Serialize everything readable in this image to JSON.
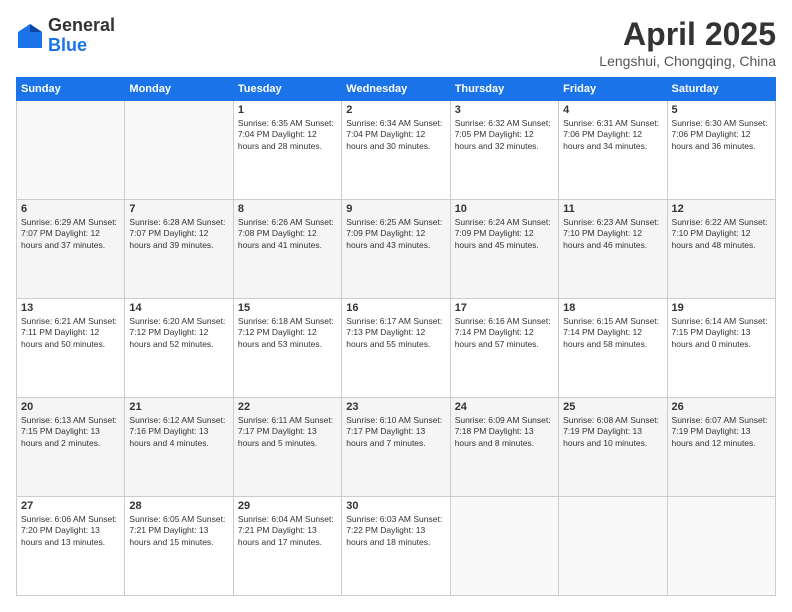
{
  "header": {
    "logo_general": "General",
    "logo_blue": "Blue",
    "month_title": "April 2025",
    "location": "Lengshui, Chongqing, China"
  },
  "weekdays": [
    "Sunday",
    "Monday",
    "Tuesday",
    "Wednesday",
    "Thursday",
    "Friday",
    "Saturday"
  ],
  "weeks": [
    [
      {
        "day": "",
        "info": ""
      },
      {
        "day": "",
        "info": ""
      },
      {
        "day": "1",
        "info": "Sunrise: 6:35 AM\nSunset: 7:04 PM\nDaylight: 12 hours\nand 28 minutes."
      },
      {
        "day": "2",
        "info": "Sunrise: 6:34 AM\nSunset: 7:04 PM\nDaylight: 12 hours\nand 30 minutes."
      },
      {
        "day": "3",
        "info": "Sunrise: 6:32 AM\nSunset: 7:05 PM\nDaylight: 12 hours\nand 32 minutes."
      },
      {
        "day": "4",
        "info": "Sunrise: 6:31 AM\nSunset: 7:06 PM\nDaylight: 12 hours\nand 34 minutes."
      },
      {
        "day": "5",
        "info": "Sunrise: 6:30 AM\nSunset: 7:06 PM\nDaylight: 12 hours\nand 36 minutes."
      }
    ],
    [
      {
        "day": "6",
        "info": "Sunrise: 6:29 AM\nSunset: 7:07 PM\nDaylight: 12 hours\nand 37 minutes."
      },
      {
        "day": "7",
        "info": "Sunrise: 6:28 AM\nSunset: 7:07 PM\nDaylight: 12 hours\nand 39 minutes."
      },
      {
        "day": "8",
        "info": "Sunrise: 6:26 AM\nSunset: 7:08 PM\nDaylight: 12 hours\nand 41 minutes."
      },
      {
        "day": "9",
        "info": "Sunrise: 6:25 AM\nSunset: 7:09 PM\nDaylight: 12 hours\nand 43 minutes."
      },
      {
        "day": "10",
        "info": "Sunrise: 6:24 AM\nSunset: 7:09 PM\nDaylight: 12 hours\nand 45 minutes."
      },
      {
        "day": "11",
        "info": "Sunrise: 6:23 AM\nSunset: 7:10 PM\nDaylight: 12 hours\nand 46 minutes."
      },
      {
        "day": "12",
        "info": "Sunrise: 6:22 AM\nSunset: 7:10 PM\nDaylight: 12 hours\nand 48 minutes."
      }
    ],
    [
      {
        "day": "13",
        "info": "Sunrise: 6:21 AM\nSunset: 7:11 PM\nDaylight: 12 hours\nand 50 minutes."
      },
      {
        "day": "14",
        "info": "Sunrise: 6:20 AM\nSunset: 7:12 PM\nDaylight: 12 hours\nand 52 minutes."
      },
      {
        "day": "15",
        "info": "Sunrise: 6:18 AM\nSunset: 7:12 PM\nDaylight: 12 hours\nand 53 minutes."
      },
      {
        "day": "16",
        "info": "Sunrise: 6:17 AM\nSunset: 7:13 PM\nDaylight: 12 hours\nand 55 minutes."
      },
      {
        "day": "17",
        "info": "Sunrise: 6:16 AM\nSunset: 7:14 PM\nDaylight: 12 hours\nand 57 minutes."
      },
      {
        "day": "18",
        "info": "Sunrise: 6:15 AM\nSunset: 7:14 PM\nDaylight: 12 hours\nand 58 minutes."
      },
      {
        "day": "19",
        "info": "Sunrise: 6:14 AM\nSunset: 7:15 PM\nDaylight: 13 hours\nand 0 minutes."
      }
    ],
    [
      {
        "day": "20",
        "info": "Sunrise: 6:13 AM\nSunset: 7:15 PM\nDaylight: 13 hours\nand 2 minutes."
      },
      {
        "day": "21",
        "info": "Sunrise: 6:12 AM\nSunset: 7:16 PM\nDaylight: 13 hours\nand 4 minutes."
      },
      {
        "day": "22",
        "info": "Sunrise: 6:11 AM\nSunset: 7:17 PM\nDaylight: 13 hours\nand 5 minutes."
      },
      {
        "day": "23",
        "info": "Sunrise: 6:10 AM\nSunset: 7:17 PM\nDaylight: 13 hours\nand 7 minutes."
      },
      {
        "day": "24",
        "info": "Sunrise: 6:09 AM\nSunset: 7:18 PM\nDaylight: 13 hours\nand 8 minutes."
      },
      {
        "day": "25",
        "info": "Sunrise: 6:08 AM\nSunset: 7:19 PM\nDaylight: 13 hours\nand 10 minutes."
      },
      {
        "day": "26",
        "info": "Sunrise: 6:07 AM\nSunset: 7:19 PM\nDaylight: 13 hours\nand 12 minutes."
      }
    ],
    [
      {
        "day": "27",
        "info": "Sunrise: 6:06 AM\nSunset: 7:20 PM\nDaylight: 13 hours\nand 13 minutes."
      },
      {
        "day": "28",
        "info": "Sunrise: 6:05 AM\nSunset: 7:21 PM\nDaylight: 13 hours\nand 15 minutes."
      },
      {
        "day": "29",
        "info": "Sunrise: 6:04 AM\nSunset: 7:21 PM\nDaylight: 13 hours\nand 17 minutes."
      },
      {
        "day": "30",
        "info": "Sunrise: 6:03 AM\nSunset: 7:22 PM\nDaylight: 13 hours\nand 18 minutes."
      },
      {
        "day": "",
        "info": ""
      },
      {
        "day": "",
        "info": ""
      },
      {
        "day": "",
        "info": ""
      }
    ]
  ]
}
